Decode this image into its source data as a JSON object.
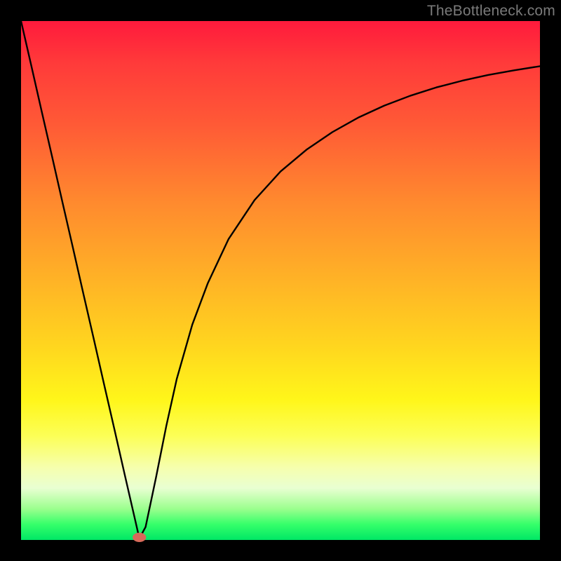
{
  "watermark": "TheBottleneck.com",
  "chart_data": {
    "type": "line",
    "title": "",
    "xlabel": "",
    "ylabel": "",
    "xlim": [
      0,
      100
    ],
    "ylim": [
      0,
      100
    ],
    "series": [
      {
        "name": "curve",
        "x": [
          0,
          2,
          4,
          6,
          8,
          10,
          12,
          14,
          16,
          18,
          20,
          22,
          22.8,
          24,
          26,
          28,
          30,
          33,
          36,
          40,
          45,
          50,
          55,
          60,
          65,
          70,
          75,
          80,
          85,
          90,
          95,
          100
        ],
        "y": [
          100,
          91.3,
          82.5,
          73.8,
          65.0,
          56.3,
          47.5,
          38.8,
          30.0,
          21.3,
          12.5,
          3.8,
          0.3,
          2.5,
          12.0,
          22.0,
          31.0,
          41.5,
          49.5,
          58.0,
          65.5,
          71.0,
          75.2,
          78.6,
          81.4,
          83.7,
          85.6,
          87.2,
          88.5,
          89.6,
          90.5,
          91.3
        ]
      }
    ],
    "marker": {
      "x": 22.8,
      "y": 0.5,
      "rx": 1.3,
      "ry": 0.9
    },
    "background_gradient": {
      "stops": [
        {
          "pos": 0.0,
          "color": "#ff1a3c"
        },
        {
          "pos": 0.5,
          "color": "#ffb326"
        },
        {
          "pos": 0.8,
          "color": "#fcff57"
        },
        {
          "pos": 1.0,
          "color": "#00e765"
        }
      ],
      "direction": "top-to-bottom"
    }
  }
}
